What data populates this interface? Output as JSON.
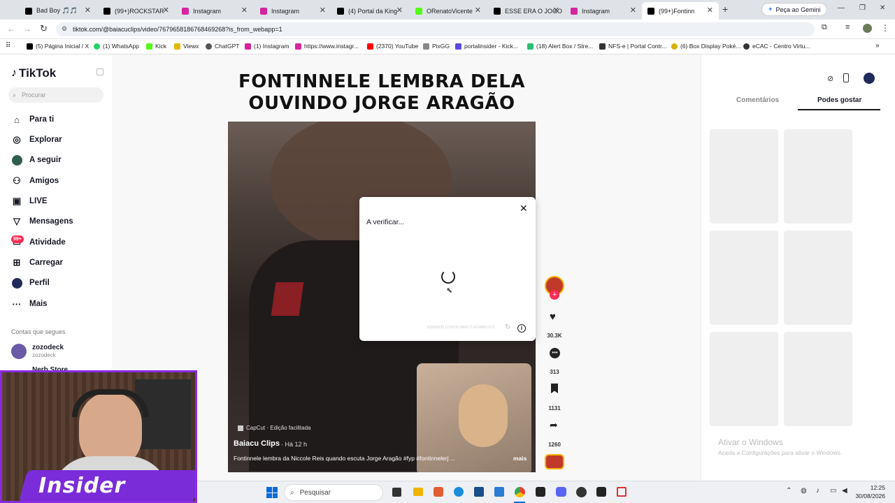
{
  "browser": {
    "tabs": [
      {
        "label": "Bad Boy 🎵🎵",
        "color": "#000"
      },
      {
        "label": "(99+)ROCKSTAR",
        "color": "#000"
      },
      {
        "label": "Instagram",
        "color": "#d6249f"
      },
      {
        "label": "Instagram",
        "color": "#d6249f"
      },
      {
        "label": "(4) Portal da King",
        "color": "#000"
      },
      {
        "label": "ORenatoVicente",
        "color": "#53fc18"
      },
      {
        "label": "ESSE ERA O JOGO",
        "color": "#000"
      },
      {
        "label": "Instagram",
        "color": "#d6249f"
      },
      {
        "label": "(99+)Fontinn",
        "color": "#000"
      }
    ],
    "gemini_button": "Peça ao Gemini",
    "url": "tiktok.com/@baiacuclips/video/7679658186768469268?is_from_webapp=1",
    "bookmarks": [
      {
        "label": "(5) Página Inicial / X",
        "color": "#000"
      },
      {
        "label": "(1) WhatsApp",
        "color": "#25d366"
      },
      {
        "label": "Kick",
        "color": "#53fc18"
      },
      {
        "label": "Viewx",
        "color": "#e6b800"
      },
      {
        "label": "ChatGPT",
        "color": "#555"
      },
      {
        "label": "(1) Instagram",
        "color": "#d6249f"
      },
      {
        "label": "https://www.instagr...",
        "color": "#d6249f"
      },
      {
        "label": "(2370) YouTube",
        "color": "#ff0000"
      },
      {
        "label": "PixGG",
        "color": "#888"
      },
      {
        "label": "portalinsider - Kick...",
        "color": "#5b4be0"
      },
      {
        "label": "(18) Alert Box / Stre...",
        "color": "#2fbf71"
      },
      {
        "label": "NFS-e | Portal Contr...",
        "color": "#333"
      },
      {
        "label": "(6) Box Display Poké...",
        "color": "#d4b300"
      },
      {
        "label": "eCAC - Centro Virtu...",
        "color": "#333"
      }
    ]
  },
  "tiktok": {
    "logo": "TikTok",
    "search_placeholder": "Procurar",
    "nav": [
      "Para ti",
      "Explorar",
      "A seguir",
      "Amigos",
      "LIVE",
      "Mensagens",
      "Atividade",
      "Carregar",
      "Perfil",
      "Mais"
    ],
    "activity_badge": "99+",
    "following_heading": "Contas que segues",
    "following": [
      {
        "name": "zozodeck",
        "handle": "zozodeck"
      },
      {
        "name": "Nerb Store",
        "handle": ""
      }
    ],
    "video_title_line1": "FONTINNELE LEMBRA DELA",
    "video_title_line2": "OUVINDO JORGE ARAGÃO",
    "capcut": "CapCut · Edição facilitada",
    "author": "Baiacu Clips",
    "time_ago": "· Há 12 h",
    "caption": "Fontinnele lembra da Niccole Reis quando escuta Jorge Aragão #fyp #fontinnelerj ...",
    "more": "mais",
    "likes": "30.3K",
    "comments": "313",
    "saves": "1131",
    "shares": "1260",
    "panel_tabs": [
      "Comentários",
      "Podes gostar"
    ],
    "windows_watermark_title": "Ativar o Windows",
    "windows_watermark_sub": "Aceda a Configurações para ativar o Windows."
  },
  "modal": {
    "title": "A verificar...",
    "footer_code": "2026/08/30 12:50:00 NIK/C-T-0F1B860-C72"
  },
  "taskbar": {
    "search": "Pesquisar",
    "time": "12:25",
    "date": "30/08/2026"
  },
  "webcam": {
    "logo": "Insider"
  }
}
